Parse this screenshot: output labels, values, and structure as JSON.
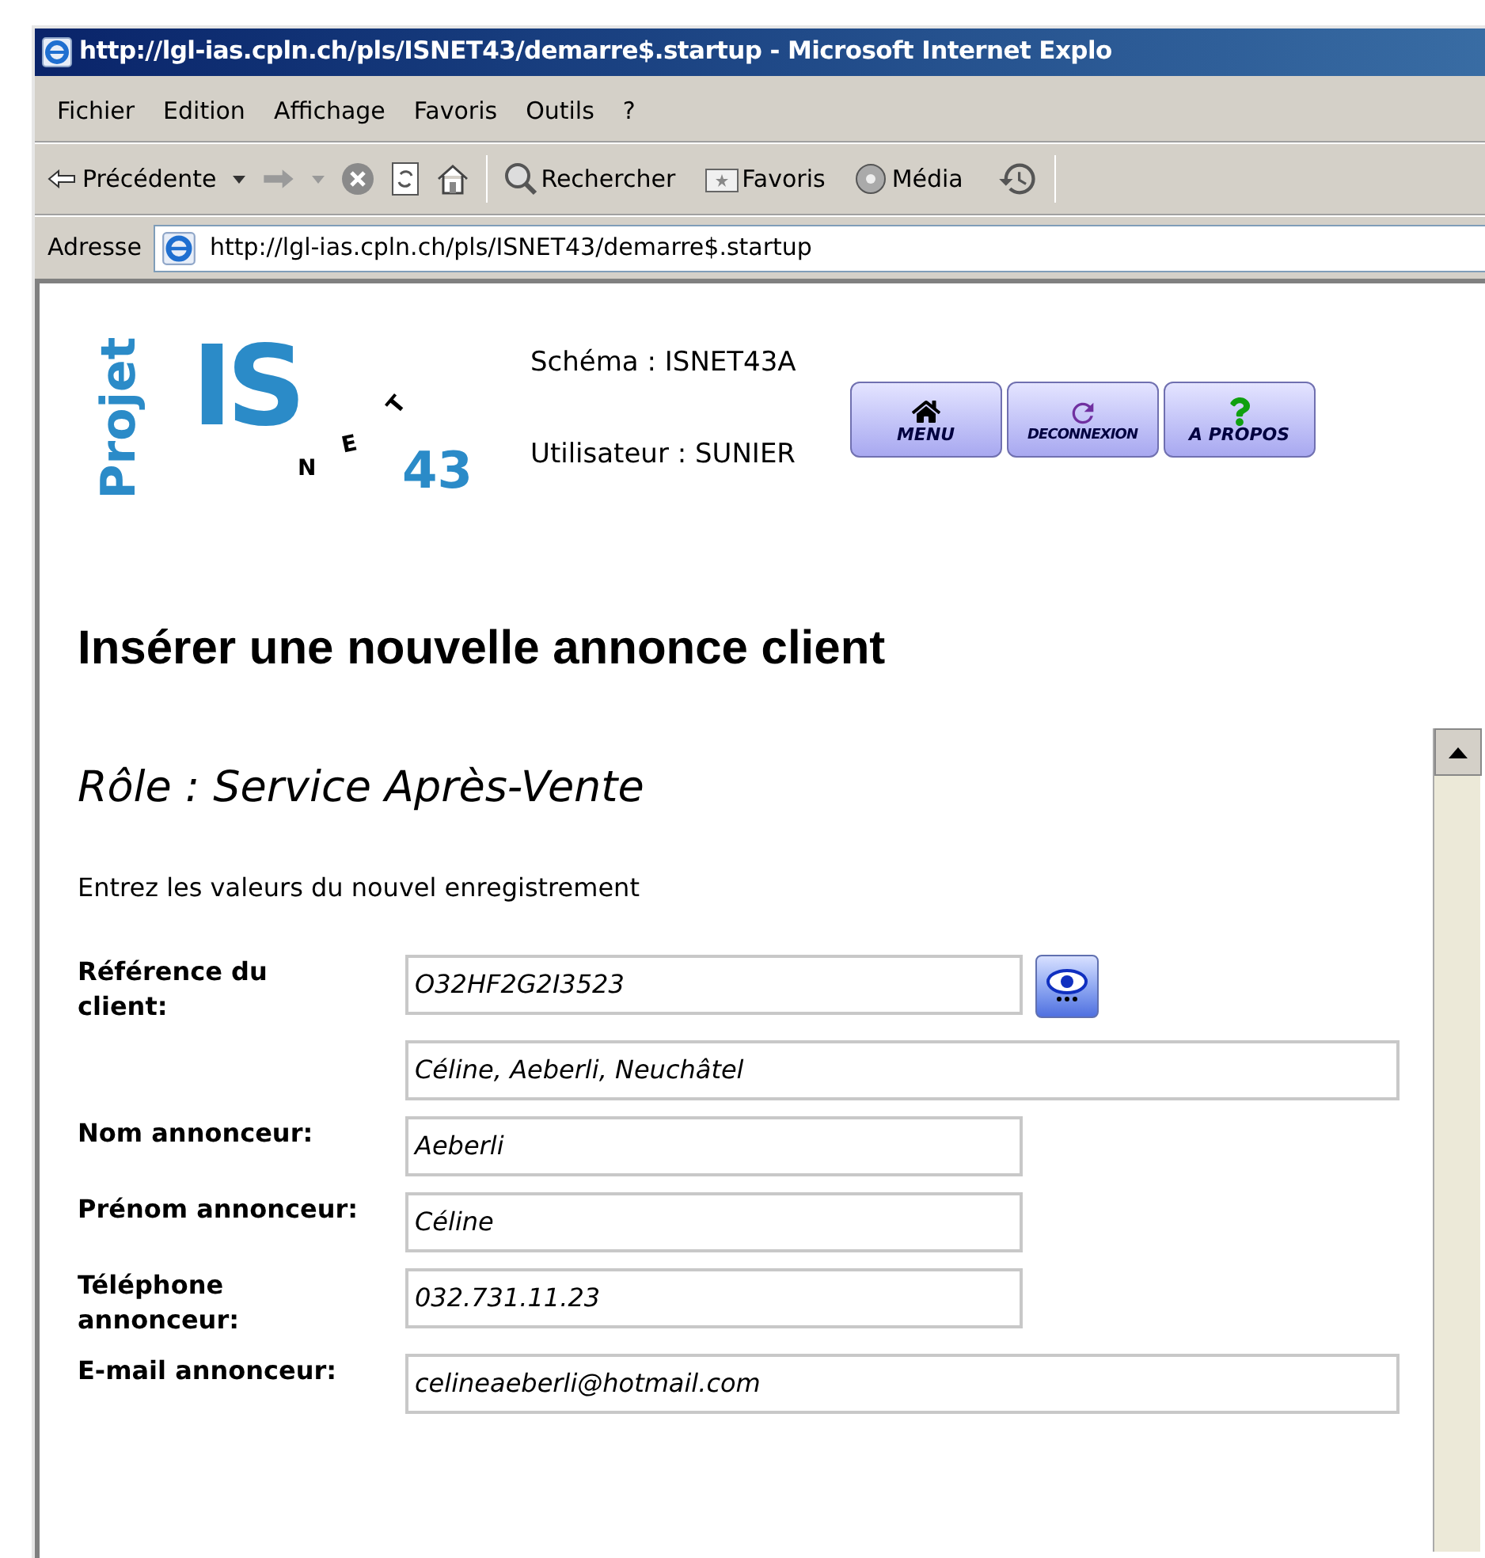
{
  "window": {
    "title": "http://lgl-ias.cpln.ch/pls/ISNET43/demarre$.startup - Microsoft Internet Explo"
  },
  "menu": [
    "Fichier",
    "Edition",
    "Affichage",
    "Favoris",
    "Outils",
    "?"
  ],
  "toolbar": {
    "back": "Précédente",
    "search": "Rechercher",
    "favorites": "Favoris",
    "media": "Média"
  },
  "address": {
    "label": "Adresse",
    "value": "http://lgl-ias.cpln.ch/pls/ISNET43/demarre$.startup"
  },
  "logo": {
    "vertical": "Projet",
    "main": "IS",
    "letters": [
      "N",
      "E",
      "T"
    ],
    "number": "43"
  },
  "session": [
    "Schéma : ISNET43A",
    "Utilisateur : SUNIER"
  ],
  "nav_buttons": [
    {
      "kind": "home",
      "label": "MENU"
    },
    {
      "kind": "logout",
      "label": "DECONNEXION"
    },
    {
      "kind": "help",
      "label": "A PROPOS"
    }
  ],
  "heading": "Insérer une nouvelle annonce client",
  "role": "Rôle : Service Après-Vente",
  "instruction": "Entrez les valeurs du nouvel enregistrement",
  "fields": [
    {
      "kind": "lookup",
      "label": "Référence du client:",
      "value": "O32HF2G2I3523"
    },
    {
      "kind": "wide",
      "value": "Céline, Aeberli, Neuchâtel"
    },
    {
      "kind": "text",
      "label": "Nom annonceur:",
      "value": "Aeberli"
    },
    {
      "kind": "text",
      "label": "Prénom annonceur:",
      "value": "Céline"
    },
    {
      "kind": "text",
      "label": "Téléphone annonceur:",
      "value": "032.731.11.23"
    },
    {
      "kind": "wide",
      "label": "E-mail annonceur:",
      "value": "celineaeberli@hotmail.com"
    }
  ]
}
